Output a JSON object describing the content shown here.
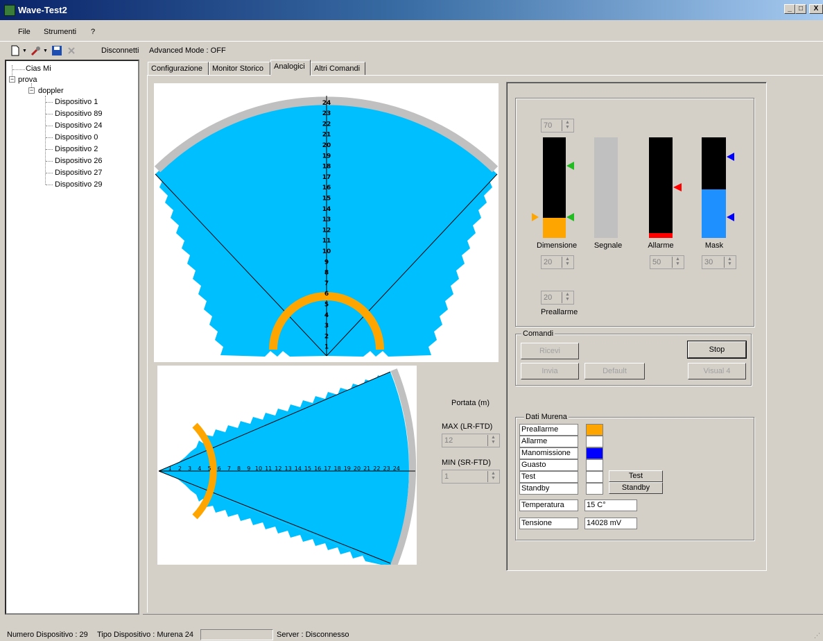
{
  "window": {
    "title": "Wave-Test2",
    "min": "_",
    "max": "□",
    "close": "X"
  },
  "menu": {
    "items": [
      "File",
      "Strumenti",
      "?"
    ]
  },
  "toolbar": {
    "disconnect": "Disconnetti",
    "advanced_mode": "Advanced Mode : OFF"
  },
  "tree": {
    "root1": "Cias Mi",
    "root2": "prova",
    "group": "doppler",
    "devices": [
      "Dispositivo 1",
      "Dispositivo 89",
      "Dispositivo 24",
      "Dispositivo 0",
      "Dispositivo 2",
      "Dispositivo 26",
      "Dispositivo 27",
      "Dispositivo 29"
    ]
  },
  "tabs": [
    {
      "label": "Configurazione"
    },
    {
      "label": "Monitor Storico"
    },
    {
      "label": "Analogici",
      "active": true
    },
    {
      "label": "Altri Comandi"
    }
  ],
  "radar": {
    "vertical_scale": [
      "24",
      "23",
      "22",
      "21",
      "20",
      "19",
      "18",
      "17",
      "16",
      "15",
      "14",
      "13",
      "12",
      "11",
      "10",
      "9",
      "8",
      "7",
      "6",
      "5",
      "4",
      "3",
      "2",
      "1"
    ],
    "horizontal_scale": [
      "1",
      "2",
      "3",
      "4",
      "5",
      "6",
      "7",
      "8",
      "9",
      "10",
      "11",
      "12",
      "13",
      "14",
      "15",
      "16",
      "17",
      "18",
      "19",
      "20",
      "21",
      "22",
      "23",
      "24"
    ],
    "highlight_range": 6,
    "colors": {
      "field": "#00bfff",
      "arc": "#ffa500",
      "rim": "#c0c0c0"
    }
  },
  "portata": {
    "title": "Portata (m)",
    "max_label": "MAX (LR-FTD)",
    "max_value": "12",
    "min_label": "MIN (SR-FTD)",
    "min_value": "1"
  },
  "analog": {
    "top_spin": "70",
    "bars": [
      {
        "label": "Dimensione",
        "fill_color": "#ffa500",
        "fill_fraction": 0.2
      },
      {
        "label": "Segnale",
        "fill_color": "#c0c0c0",
        "fill_fraction": 1.0
      },
      {
        "label": "Allarme",
        "fill_color": "#ff0000",
        "fill_fraction": 0.05
      },
      {
        "label": "Mask",
        "fill_color": "#1e90ff",
        "fill_fraction": 0.48
      }
    ],
    "spin_dimensione": "20",
    "spin_allarme": "50",
    "spin_mask": "30",
    "spin_preallarme": "20",
    "preallarme_label": "Preallarme"
  },
  "comandi": {
    "title": "Comandi",
    "ricevi": "Ricevi",
    "stop": "Stop",
    "invia": "Invia",
    "default": "Default",
    "visual": "Visual 4"
  },
  "dati": {
    "title": "Dati Murena",
    "rows": [
      {
        "label": "Preallarme",
        "color": "#ffa500"
      },
      {
        "label": "Allarme",
        "color": "#ffffff"
      },
      {
        "label": "Manomissione",
        "color": "#0000ff"
      },
      {
        "label": "Guasto",
        "color": "#ffffff"
      },
      {
        "label": "Test",
        "color": "#ffffff"
      },
      {
        "label": "Standby",
        "color": "#ffffff"
      }
    ],
    "test_button": "Test",
    "standby_button": "Standby",
    "temperatura_label": "Temperatura",
    "temperatura_value": "15 C°",
    "tensione_label": "Tensione",
    "tensione_value": "14028 mV"
  },
  "status": {
    "device_number": "Numero Dispositivo : 29",
    "device_type": "Tipo Dispositivo : Murena 24",
    "server": "Server : Disconnesso"
  }
}
